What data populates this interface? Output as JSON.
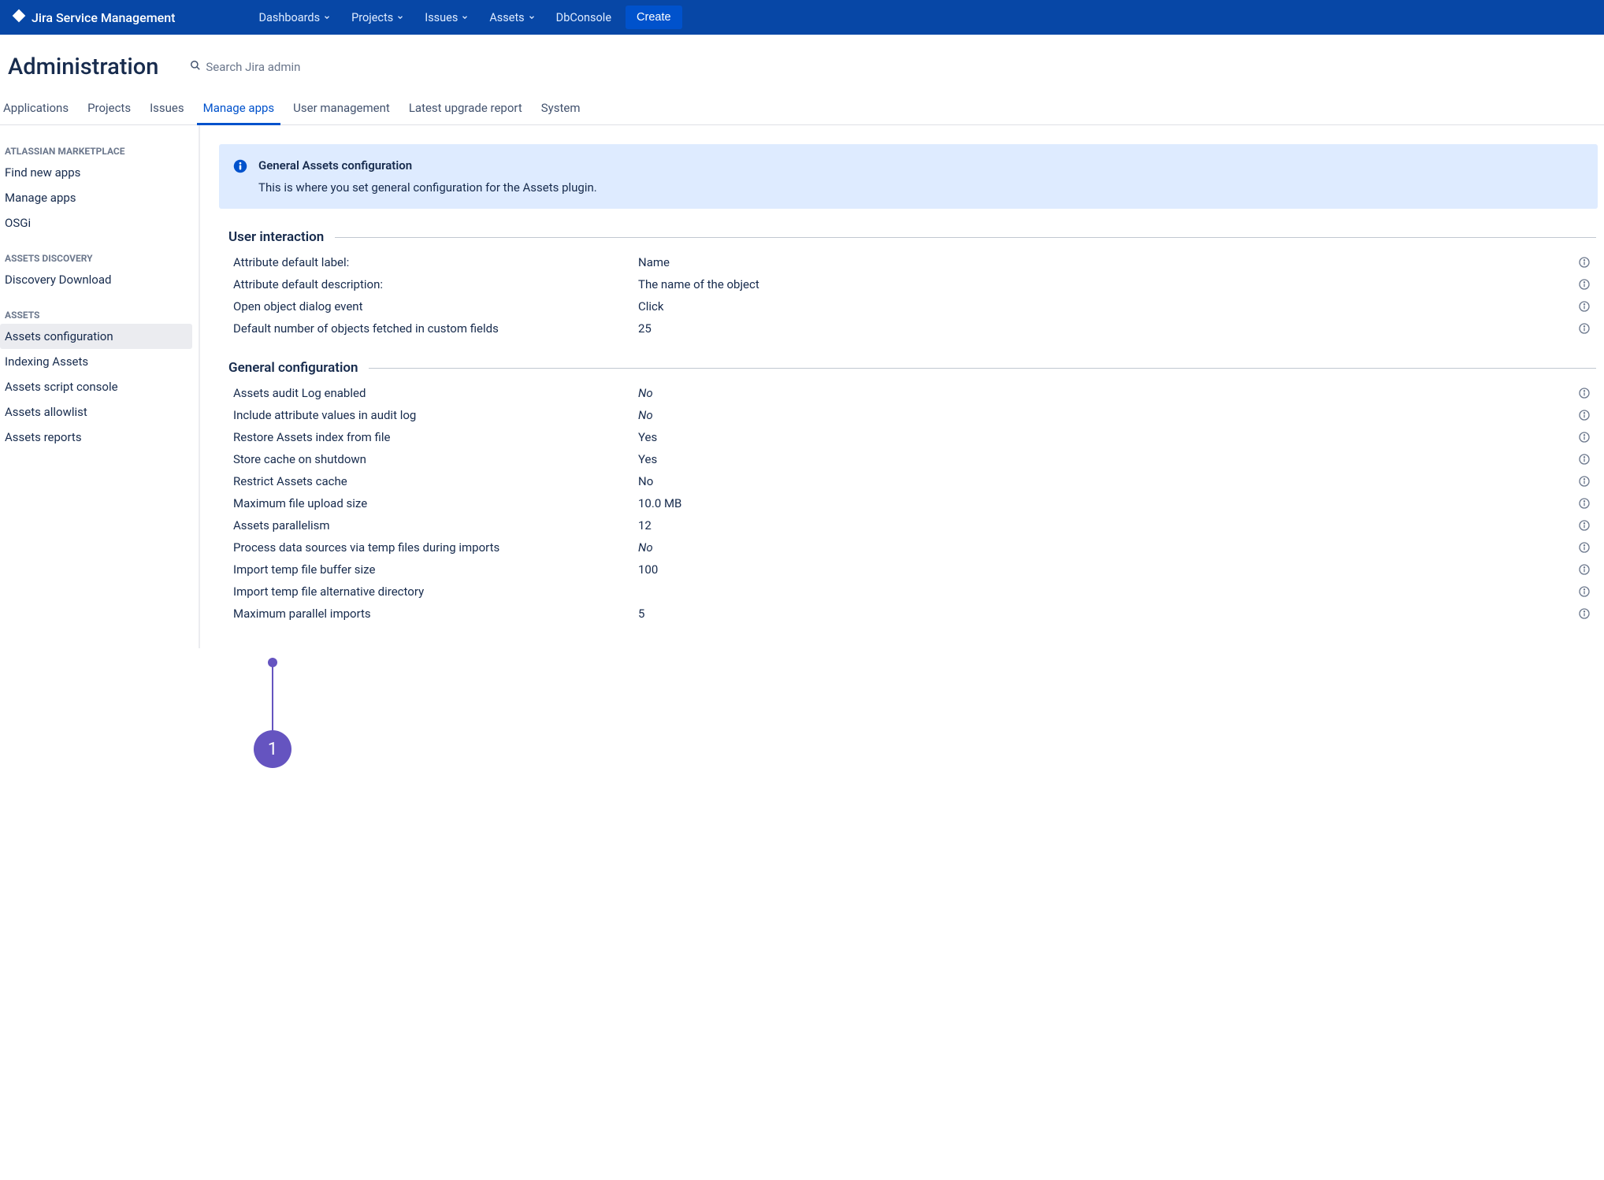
{
  "topbar": {
    "product": "Jira Service Management",
    "nav": [
      "Dashboards",
      "Projects",
      "Issues",
      "Assets",
      "DbConsole"
    ],
    "nav_has_chevron": [
      true,
      true,
      true,
      true,
      false
    ],
    "create_label": "Create"
  },
  "header": {
    "title": "Administration",
    "search_placeholder": "Search Jira admin"
  },
  "tabs": [
    "Applications",
    "Projects",
    "Issues",
    "Manage apps",
    "User management",
    "Latest upgrade report",
    "System"
  ],
  "active_tab": "Manage apps",
  "sidebar": {
    "sections": [
      {
        "title": "ATLASSIAN MARKETPLACE",
        "items": [
          "Find new apps",
          "Manage apps",
          "OSGi"
        ]
      },
      {
        "title": "ASSETS DISCOVERY",
        "items": [
          "Discovery Download"
        ]
      },
      {
        "title": "ASSETS",
        "items": [
          "Assets configuration",
          "Indexing Assets",
          "Assets script console",
          "Assets allowlist",
          "Assets reports"
        ]
      }
    ],
    "active_item": "Assets configuration"
  },
  "info_panel": {
    "title": "General Assets configuration",
    "body": "This is where you set general configuration for the Assets plugin."
  },
  "sections": [
    {
      "title": "User interaction",
      "rows": [
        {
          "label": "Attribute default label:",
          "value": "Name",
          "italic": false
        },
        {
          "label": "Attribute default description:",
          "value": "The name of the object",
          "italic": false
        },
        {
          "label": "Open object dialog event",
          "value": "Click",
          "italic": false
        },
        {
          "label": "Default number of objects fetched in custom fields",
          "value": "25",
          "italic": false
        }
      ]
    },
    {
      "title": "General configuration",
      "rows": [
        {
          "label": "Assets audit Log enabled",
          "value": "No",
          "italic": true
        },
        {
          "label": "Include attribute values in audit log",
          "value": "No",
          "italic": true
        },
        {
          "label": "Restore Assets index from file",
          "value": "Yes",
          "italic": false
        },
        {
          "label": "Store cache on shutdown",
          "value": "Yes",
          "italic": false
        },
        {
          "label": "Restrict Assets cache",
          "value": "No",
          "italic": false
        },
        {
          "label": "Maximum file upload size",
          "value": "10.0 MB",
          "italic": false
        },
        {
          "label": "Assets parallelism",
          "value": "12",
          "italic": false
        },
        {
          "label": "Process data sources via temp files during imports",
          "value": "No",
          "italic": true
        },
        {
          "label": "Import temp file buffer size",
          "value": "100",
          "italic": false
        },
        {
          "label": "Import temp file alternative directory",
          "value": "",
          "italic": false
        },
        {
          "label": "Maximum parallel imports",
          "value": "5",
          "italic": false
        }
      ]
    }
  ],
  "callout": {
    "number": "1"
  }
}
